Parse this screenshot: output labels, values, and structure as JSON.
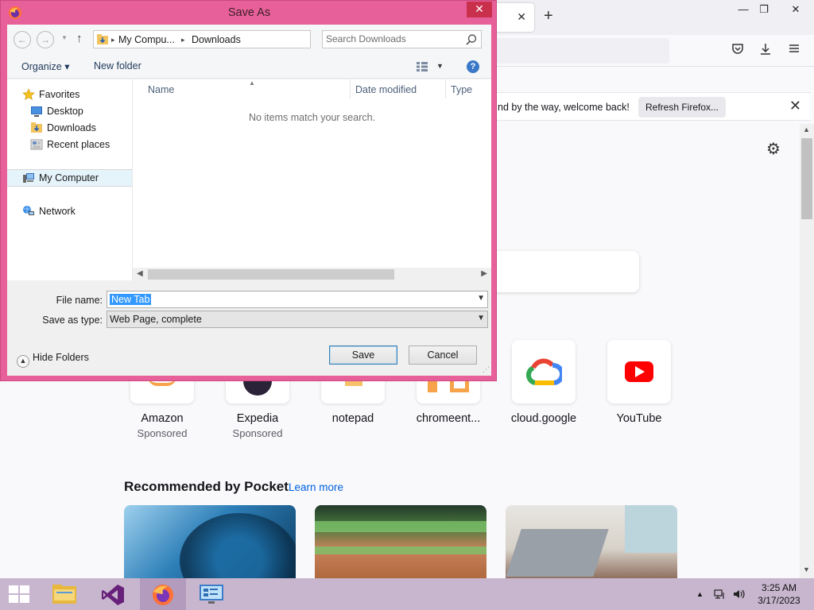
{
  "browser": {
    "notification": {
      "text": "nd by the way, welcome back!",
      "button": "Refresh Firefox..."
    },
    "shortcuts": [
      {
        "name": "Amazon",
        "sponsored": "Sponsored"
      },
      {
        "name": "Expedia",
        "sponsored": "Sponsored"
      },
      {
        "name": "notepad",
        "sponsored": ""
      },
      {
        "name": "chromeent...",
        "sponsored": ""
      },
      {
        "name": "cloud.google",
        "sponsored": ""
      },
      {
        "name": "YouTube",
        "sponsored": ""
      }
    ],
    "pocket": {
      "title": "Recommended by Pocket",
      "learn_more": "Learn more"
    }
  },
  "dialog": {
    "title": "Save As",
    "close": "✕",
    "breadcrumb": [
      "My Compu...",
      "Downloads"
    ],
    "search_placeholder": "Search Downloads",
    "toolbar": {
      "organize": "Organize ▾",
      "new_folder": "New folder"
    },
    "nav": {
      "favorites": "Favorites",
      "desktop": "Desktop",
      "downloads": "Downloads",
      "recent": "Recent places",
      "computer": "My Computer",
      "network": "Network"
    },
    "columns": {
      "name": "Name",
      "date": "Date modified",
      "type": "Type"
    },
    "empty_message": "No items match your search.",
    "form": {
      "filename_label": "File name:",
      "filename_value": "New Tab",
      "savetype_label": "Save as type:",
      "savetype_value": "Web Page, complete"
    },
    "hide_folders": "Hide Folders",
    "buttons": {
      "save": "Save",
      "cancel": "Cancel"
    }
  },
  "taskbar": {
    "time": "3:25 AM",
    "date": "3/17/2023"
  },
  "colors": {
    "dialog_frame": "#e8609a",
    "taskbar": "#c8b6cf",
    "selection": "#3399ff"
  }
}
